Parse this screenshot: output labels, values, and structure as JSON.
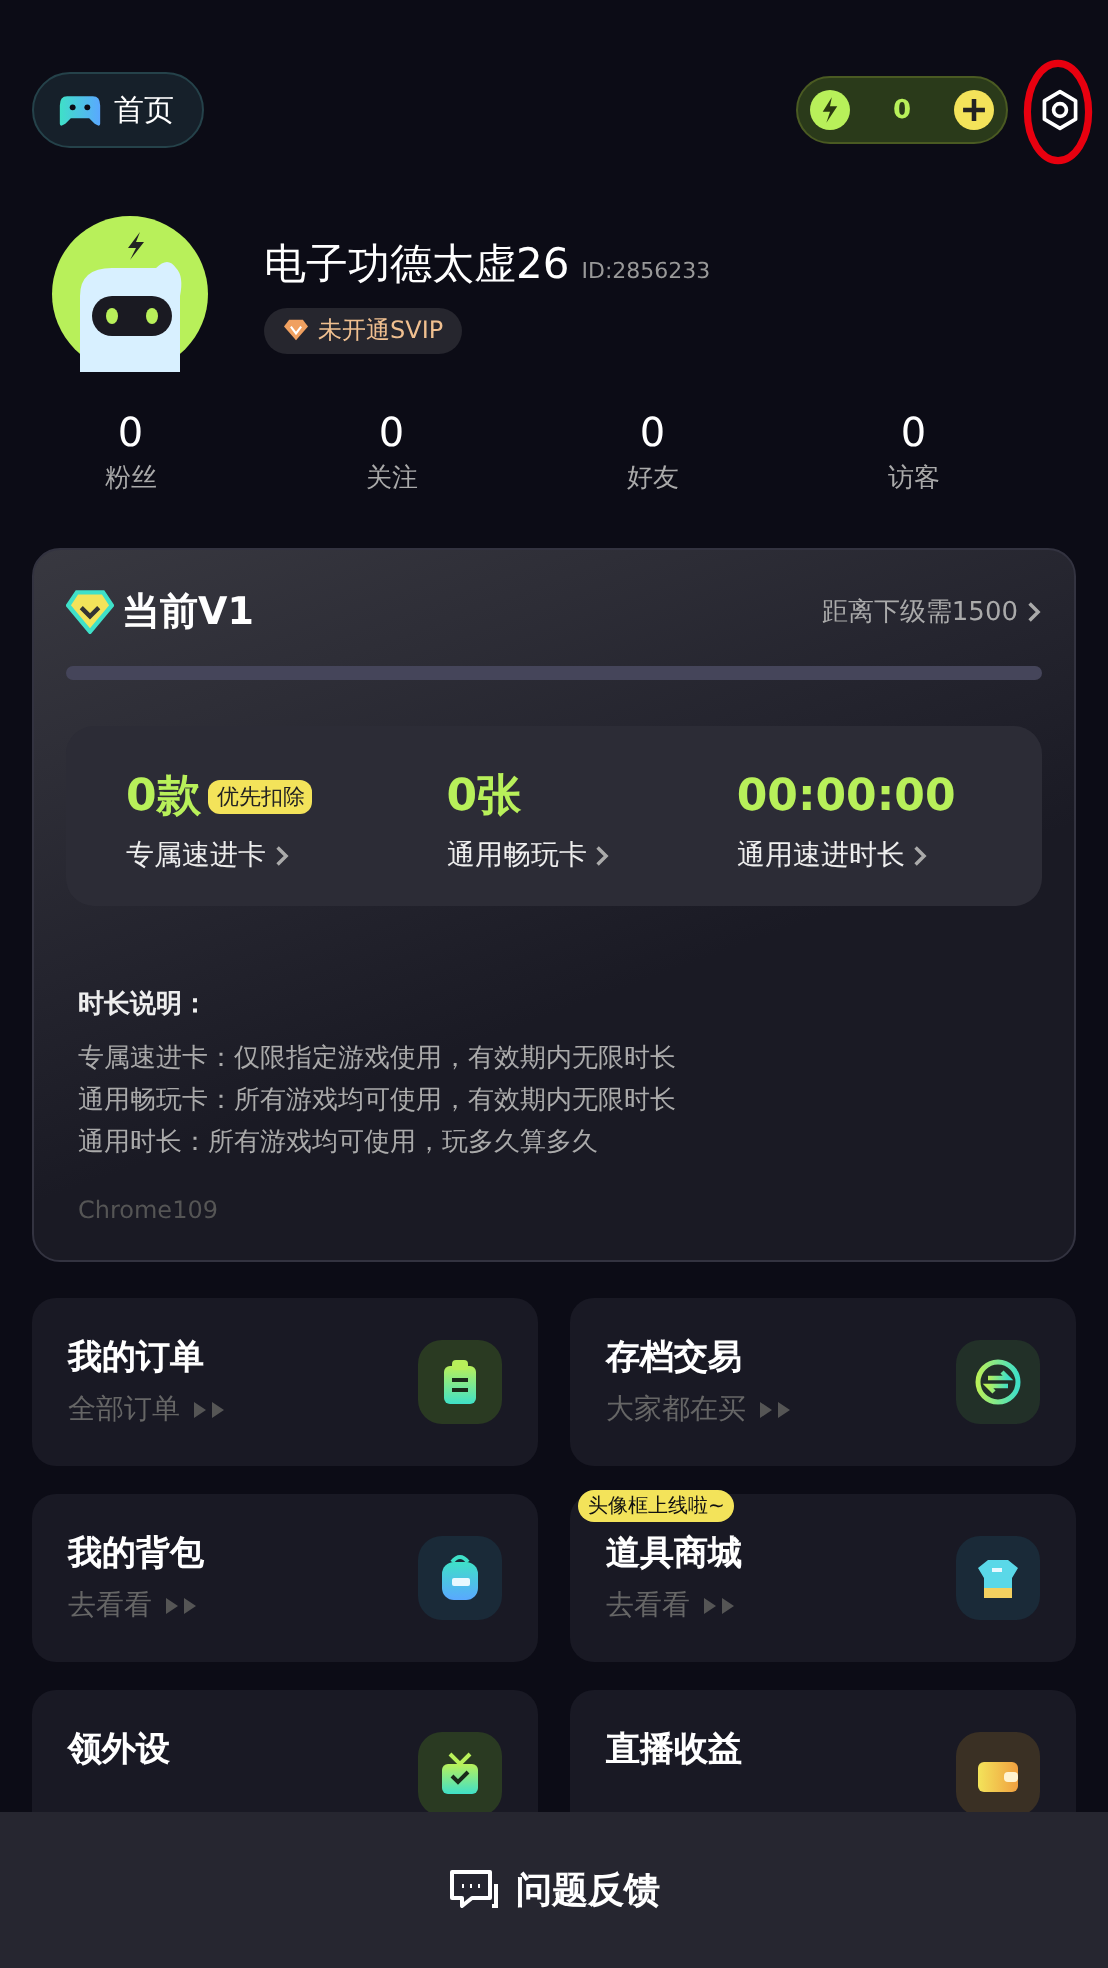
{
  "top_bar": {
    "home_label": "首页",
    "coin_count": "0",
    "settings_highlighted": true
  },
  "profile": {
    "name": "电子功德太虚26",
    "id": "ID:2856233",
    "svip_badge": "未开通SVIP"
  },
  "stats": [
    {
      "value": "0",
      "label": "粉丝"
    },
    {
      "value": "0",
      "label": "关注"
    },
    {
      "value": "0",
      "label": "好友"
    },
    {
      "value": "0",
      "label": "访客"
    }
  ],
  "vip_card": {
    "level_title": "当前V1",
    "next_level": "距离下级需1500",
    "progress": {
      "level": 0
    },
    "assets": [
      {
        "value": "0款",
        "tag": "优先扣除",
        "label": "专属速进卡"
      },
      {
        "value": "0张",
        "label": "通用畅玩卡"
      },
      {
        "value": "00:00:00",
        "label": "通用速进时长"
      }
    ],
    "notes_title": "时长说明：",
    "notes": [
      "专属速进卡：仅限指定游戏使用，有效期内无限时长",
      "通用畅玩卡：所有游戏均可使用，有效期内无限时长",
      "通用时长：所有游戏均可使用，玩多久算多久"
    ],
    "browser": "Chrome109"
  },
  "menu": [
    {
      "title": "我的订单",
      "subtitle": "全部订单",
      "kind": "clipboard"
    },
    {
      "title": "存档交易",
      "subtitle": "大家都在买",
      "kind": "exchange"
    },
    {
      "title": "我的背包",
      "subtitle": "去看看",
      "kind": "backpack"
    },
    {
      "title": "道具商城",
      "subtitle": "去看看",
      "kind": "shirt",
      "badge": "头像框上线啦~"
    },
    {
      "title": "领外设",
      "kind": "gift"
    },
    {
      "title": "直播收益",
      "kind": "wallet"
    }
  ],
  "feedback_button": "问题反馈"
}
